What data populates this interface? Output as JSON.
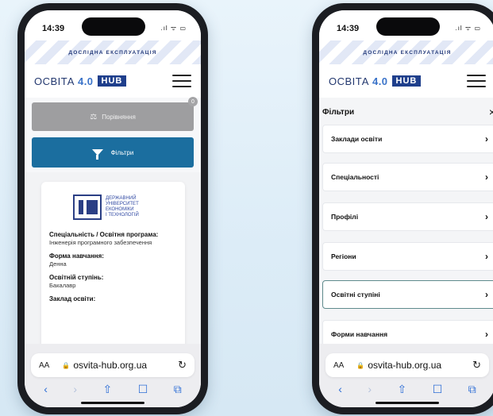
{
  "status": {
    "time": "14:39",
    "icons": ".ıl ᯤ ▭"
  },
  "banner": "ДОСЛІДНА ЕКСПЛУАТАЦІЯ",
  "logo": {
    "word": "ОСВІТА",
    "num": "4.0",
    "hub": "HUB"
  },
  "left": {
    "compare_label": "Порівняння",
    "compare_count": "0",
    "filter_label": "Фільтри",
    "uni_name": [
      "ДЕРЖАВНИЙ",
      "УНІВЕРСИТЕТ",
      "ЕКОНОМІКИ",
      "І ТЕХНОЛОГІЙ"
    ],
    "fields": [
      {
        "label": "Спеціальність / Освітня програма:",
        "value": "Інженерія програмного забезпечення"
      },
      {
        "label": "Форма навчання:",
        "value": "Денна"
      },
      {
        "label": "Освітній ступінь:",
        "value": "Бакалавр"
      },
      {
        "label": "Заклад освіти:",
        "value": ""
      }
    ]
  },
  "right": {
    "panel_title": "Фільтри",
    "close": "×",
    "options": [
      "Заклади освіти",
      "Спеціальності",
      "Профілі",
      "Регіони",
      "Освітні ступіні",
      "Форми навчання"
    ]
  },
  "browser": {
    "aa": "AA",
    "url": "osvita-hub.org.ua",
    "toolbar": {
      "back": "‹",
      "forward": "›",
      "share": "⇧",
      "books": "📖",
      "tabs": "⧉"
    }
  }
}
